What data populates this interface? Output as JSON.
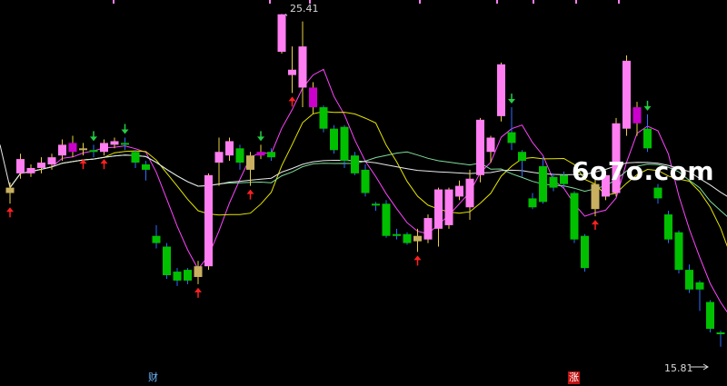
{
  "chart_data": {
    "type": "candlestick",
    "title": "",
    "xlabel": "",
    "ylabel": "",
    "ylim": [
      15.0,
      25.8
    ],
    "high_label": "25.41",
    "low_label": "15.81",
    "watermark": "6o7o.com",
    "event_markers": [
      {
        "name": "cai",
        "label": "财",
        "color": "#6fb8ff"
      },
      {
        "name": "zhang",
        "label": "涨",
        "color": "#c01010"
      }
    ],
    "colors": {
      "up": "#ff7ef2",
      "up_strong": "#cc00cc",
      "down": "#00c000",
      "doji": "#c8b060",
      "wick_up": "#e8d040",
      "wick_down": "#2d6cff",
      "ma5": "#ff44ff",
      "ma10": "#e6e600",
      "ma20": "#7fdc9a",
      "ma60": "#e8e8e8",
      "buy_arrow": "#ff2020",
      "sell_arrow": "#22cc44"
    },
    "series_ma": [
      {
        "key": "ma5",
        "color_key": "ma5"
      },
      {
        "key": "ma10",
        "color_key": "ma10"
      },
      {
        "key": "ma20",
        "color_key": "ma20"
      },
      {
        "key": "ma60",
        "color_key": "ma60"
      }
    ],
    "candles": [
      {
        "o": 20.4,
        "c": 20.55,
        "h": 20.7,
        "l": 20.1,
        "style": "doji",
        "sig": "buy"
      },
      {
        "o": 20.95,
        "c": 21.35,
        "h": 21.5,
        "l": 20.8,
        "style": "up"
      },
      {
        "o": 20.95,
        "c": 21.1,
        "h": 21.2,
        "l": 20.85,
        "style": "up"
      },
      {
        "o": 21.1,
        "c": 21.25,
        "h": 21.4,
        "l": 20.95,
        "style": "up"
      },
      {
        "o": 21.2,
        "c": 21.4,
        "h": 21.5,
        "l": 21.05,
        "style": "up"
      },
      {
        "o": 21.45,
        "c": 21.75,
        "h": 21.9,
        "l": 21.3,
        "style": "up"
      },
      {
        "o": 21.8,
        "c": 21.55,
        "h": 22.0,
        "l": 21.4,
        "style": "up_strong"
      },
      {
        "o": 21.6,
        "c": 21.65,
        "h": 21.8,
        "l": 21.45,
        "style": "doji",
        "sig": "buy"
      },
      {
        "o": 21.6,
        "c": 21.55,
        "h": 21.75,
        "l": 21.4,
        "style": "down",
        "sig": "sell"
      },
      {
        "o": 21.55,
        "c": 21.8,
        "h": 21.9,
        "l": 21.45,
        "style": "up",
        "sig": "buy"
      },
      {
        "o": 21.75,
        "c": 21.85,
        "h": 21.95,
        "l": 21.65,
        "style": "up"
      },
      {
        "o": 21.8,
        "c": 21.75,
        "h": 21.95,
        "l": 21.6,
        "style": "down",
        "sig": "sell"
      },
      {
        "o": 21.55,
        "c": 21.25,
        "h": 21.6,
        "l": 21.1,
        "style": "down"
      },
      {
        "o": 21.2,
        "c": 21.05,
        "h": 21.3,
        "l": 20.75,
        "style": "down"
      },
      {
        "o": 19.2,
        "c": 19.0,
        "h": 19.5,
        "l": 18.85,
        "style": "down"
      },
      {
        "o": 18.9,
        "c": 18.1,
        "h": 19.0,
        "l": 18.0,
        "style": "down"
      },
      {
        "o": 18.2,
        "c": 17.95,
        "h": 18.3,
        "l": 17.8,
        "style": "down"
      },
      {
        "o": 18.25,
        "c": 17.95,
        "h": 18.3,
        "l": 17.85,
        "style": "down"
      },
      {
        "o": 18.05,
        "c": 18.35,
        "h": 18.5,
        "l": 17.85,
        "style": "doji",
        "sig": "buy"
      },
      {
        "o": 18.35,
        "c": 20.9,
        "h": 20.95,
        "l": 18.25,
        "style": "up"
      },
      {
        "o": 21.25,
        "c": 21.55,
        "h": 21.95,
        "l": 20.6,
        "style": "up"
      },
      {
        "o": 21.45,
        "c": 21.85,
        "h": 21.95,
        "l": 21.3,
        "style": "up"
      },
      {
        "o": 21.65,
        "c": 21.25,
        "h": 21.75,
        "l": 21.05,
        "style": "down"
      },
      {
        "o": 21.05,
        "c": 21.45,
        "h": 21.55,
        "l": 20.6,
        "style": "doji",
        "sig": "buy"
      },
      {
        "o": 21.45,
        "c": 21.55,
        "h": 21.75,
        "l": 21.35,
        "style": "up_strong",
        "sig": "sell"
      },
      {
        "o": 21.55,
        "c": 21.4,
        "h": 21.65,
        "l": 21.3,
        "style": "down"
      },
      {
        "o": 24.35,
        "c": 25.4,
        "h": 25.41,
        "l": 24.3,
        "style": "up"
      },
      {
        "o": 23.7,
        "c": 23.85,
        "h": 24.5,
        "l": 23.2,
        "style": "up",
        "sig": "buy"
      },
      {
        "o": 23.35,
        "c": 24.5,
        "h": 25.2,
        "l": 22.8,
        "style": "up"
      },
      {
        "o": 22.8,
        "c": 23.35,
        "h": 23.5,
        "l": 22.6,
        "style": "up_strong"
      },
      {
        "o": 22.8,
        "c": 22.2,
        "h": 22.85,
        "l": 22.1,
        "style": "down"
      },
      {
        "o": 22.2,
        "c": 21.6,
        "h": 22.3,
        "l": 21.5,
        "style": "down"
      },
      {
        "o": 22.25,
        "c": 21.3,
        "h": 22.3,
        "l": 21.1,
        "style": "down"
      },
      {
        "o": 21.45,
        "c": 20.95,
        "h": 21.55,
        "l": 20.9,
        "style": "down"
      },
      {
        "o": 21.05,
        "c": 20.4,
        "h": 21.2,
        "l": 20.3,
        "style": "down"
      },
      {
        "o": 20.1,
        "c": 20.05,
        "h": 20.15,
        "l": 19.9,
        "style": "down"
      },
      {
        "o": 20.1,
        "c": 19.2,
        "h": 20.2,
        "l": 19.15,
        "style": "down"
      },
      {
        "o": 19.25,
        "c": 19.2,
        "h": 19.4,
        "l": 19.1,
        "style": "down"
      },
      {
        "o": 19.25,
        "c": 19.0,
        "h": 19.3,
        "l": 18.95,
        "style": "down"
      },
      {
        "o": 19.05,
        "c": 19.2,
        "h": 19.4,
        "l": 18.75,
        "style": "doji",
        "sig": "buy"
      },
      {
        "o": 19.1,
        "c": 19.7,
        "h": 19.8,
        "l": 19.0,
        "style": "up"
      },
      {
        "o": 19.4,
        "c": 20.5,
        "h": 20.55,
        "l": 18.9,
        "style": "up"
      },
      {
        "o": 19.5,
        "c": 20.5,
        "h": 20.55,
        "l": 19.4,
        "style": "up"
      },
      {
        "o": 20.3,
        "c": 20.6,
        "h": 20.75,
        "l": 20.2,
        "style": "up"
      },
      {
        "o": 20.0,
        "c": 20.8,
        "h": 21.05,
        "l": 19.65,
        "style": "up"
      },
      {
        "o": 20.9,
        "c": 22.45,
        "h": 22.5,
        "l": 20.7,
        "style": "up"
      },
      {
        "o": 21.55,
        "c": 21.95,
        "h": 22.0,
        "l": 21.25,
        "style": "up"
      },
      {
        "o": 22.55,
        "c": 24.0,
        "h": 24.05,
        "l": 22.4,
        "style": "up"
      },
      {
        "o": 22.1,
        "c": 21.8,
        "h": 22.8,
        "l": 21.6,
        "style": "down",
        "sig": "sell"
      },
      {
        "o": 21.55,
        "c": 21.3,
        "h": 21.6,
        "l": 20.85,
        "style": "down"
      },
      {
        "o": 20.25,
        "c": 20.0,
        "h": 20.4,
        "l": 19.95,
        "style": "down"
      },
      {
        "o": 21.15,
        "c": 20.15,
        "h": 21.4,
        "l": 20.1,
        "style": "down"
      },
      {
        "o": 20.85,
        "c": 20.55,
        "h": 20.95,
        "l": 20.45,
        "style": "down"
      },
      {
        "o": 20.9,
        "c": 20.65,
        "h": 21.0,
        "l": 20.55,
        "style": "down"
      },
      {
        "o": 20.4,
        "c": 19.1,
        "h": 20.45,
        "l": 19.0,
        "style": "down"
      },
      {
        "o": 19.2,
        "c": 18.3,
        "h": 19.25,
        "l": 18.2,
        "style": "down"
      },
      {
        "o": 19.95,
        "c": 20.65,
        "h": 20.8,
        "l": 19.75,
        "style": "doji",
        "sig": "buy"
      },
      {
        "o": 20.3,
        "c": 20.9,
        "h": 21.0,
        "l": 20.2,
        "style": "up"
      },
      {
        "o": 20.4,
        "c": 22.35,
        "h": 22.5,
        "l": 20.3,
        "style": "up"
      },
      {
        "o": 22.2,
        "c": 24.1,
        "h": 24.25,
        "l": 22.0,
        "style": "up"
      },
      {
        "o": 22.8,
        "c": 22.35,
        "h": 22.95,
        "l": 22.0,
        "style": "up_strong"
      },
      {
        "o": 22.2,
        "c": 21.65,
        "h": 22.6,
        "l": 21.55,
        "style": "down",
        "sig": "sell"
      },
      {
        "o": 20.55,
        "c": 20.25,
        "h": 20.65,
        "l": 20.1,
        "style": "down"
      },
      {
        "o": 19.8,
        "c": 19.1,
        "h": 19.9,
        "l": 19.0,
        "style": "down"
      },
      {
        "o": 19.3,
        "c": 18.25,
        "h": 19.35,
        "l": 18.15,
        "style": "down"
      },
      {
        "o": 18.25,
        "c": 17.7,
        "h": 18.4,
        "l": 17.6,
        "style": "down"
      },
      {
        "o": 17.9,
        "c": 17.7,
        "h": 17.95,
        "l": 17.1,
        "style": "down"
      },
      {
        "o": 17.35,
        "c": 16.6,
        "h": 17.4,
        "l": 16.5,
        "style": "down"
      },
      {
        "o": 16.5,
        "c": 16.45,
        "h": 16.55,
        "l": 16.1,
        "style": "down"
      },
      {
        "o": 16.5,
        "c": 16.1,
        "h": 16.55,
        "l": 16.0,
        "style": "down"
      },
      {
        "o": 15.72,
        "c": 15.7,
        "h": 15.8,
        "l": 15.5,
        "style": "down"
      },
      {
        "o": 16.05,
        "c": 16.5,
        "h": 16.9,
        "l": 15.81,
        "style": "doji",
        "sig": "buy"
      }
    ]
  }
}
